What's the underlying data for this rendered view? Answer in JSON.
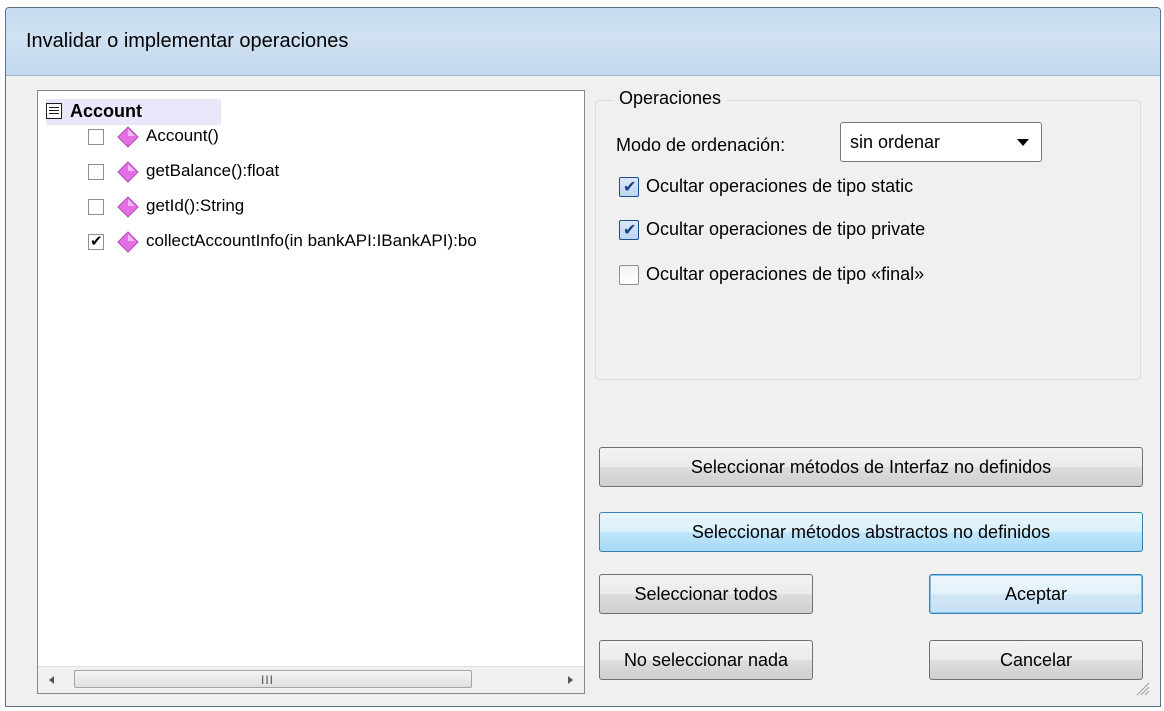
{
  "window": {
    "title": "Invalidar o implementar operaciones"
  },
  "tree": {
    "root": {
      "label": "Account"
    },
    "items": [
      {
        "label": "Account()",
        "checked": false
      },
      {
        "label": "getBalance():float",
        "checked": false
      },
      {
        "label": "getId():String",
        "checked": false
      },
      {
        "label": "collectAccountInfo(in bankAPI:IBankAPI):bo",
        "checked": true
      }
    ],
    "scrollbar": {
      "grip": "III"
    }
  },
  "operations": {
    "group_label": "Operaciones",
    "sort_mode_label": "Modo de ordenación:",
    "sort_mode_value": "sin ordenar",
    "options": [
      {
        "label": "Ocultar operaciones de tipo static",
        "checked": true
      },
      {
        "label": "Ocultar operaciones de tipo private",
        "checked": true
      },
      {
        "label": "Ocultar operaciones de tipo «final»",
        "checked": false
      }
    ]
  },
  "buttons": {
    "select_interface": "Seleccionar métodos de Interfaz no definidos",
    "select_abstract": "Seleccionar métodos abstractos no definidos",
    "select_all": "Seleccionar todos",
    "select_none": "No seleccionar nada",
    "ok": "Aceptar",
    "cancel": "Cancelar"
  },
  "icons": {
    "operation": "operation-diamond-icon",
    "tree_expand": "collapse-node-icon"
  },
  "colors": {
    "operation_icon": "#e46ee6",
    "title_bar": "#c9ddf2",
    "root_highlight": "#e8e8fa"
  }
}
